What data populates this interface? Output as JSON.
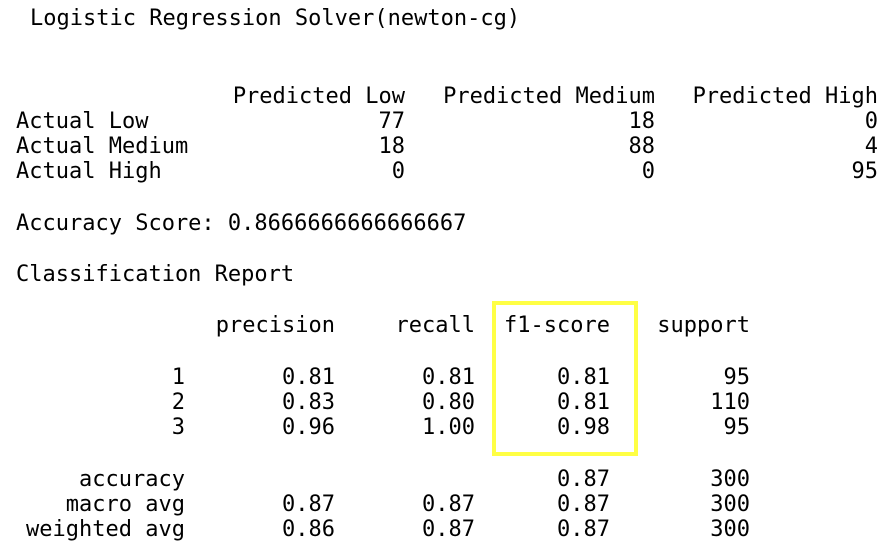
{
  "title": "Logistic Regression Solver(newton-cg)",
  "confusion_matrix": {
    "columns": [
      "Predicted Low",
      "Predicted Medium",
      "Predicted High"
    ],
    "rows": [
      {
        "label": "Actual Low",
        "values": [
          "77",
          "18",
          "0"
        ]
      },
      {
        "label": "Actual Medium",
        "values": [
          "18",
          "88",
          "4"
        ]
      },
      {
        "label": "Actual High",
        "values": [
          "0",
          "0",
          "95"
        ]
      }
    ]
  },
  "accuracy_line": "Accuracy Score: 0.8666666666666667",
  "report": {
    "title": "Classification Report",
    "headers": [
      "precision",
      "recall",
      "f1-score",
      "support"
    ],
    "class_rows": [
      {
        "label": "1",
        "precision": "0.81",
        "recall": "0.81",
        "f1": "0.81",
        "support": "95"
      },
      {
        "label": "2",
        "precision": "0.83",
        "recall": "0.80",
        "f1": "0.81",
        "support": "110"
      },
      {
        "label": "3",
        "precision": "0.96",
        "recall": "1.00",
        "f1": "0.98",
        "support": "95"
      }
    ],
    "summary_rows": [
      {
        "label": "accuracy",
        "precision": "",
        "recall": "",
        "f1": "0.87",
        "support": "300"
      },
      {
        "label": "macro avg",
        "precision": "0.87",
        "recall": "0.87",
        "f1": "0.87",
        "support": "300"
      },
      {
        "label": "weighted avg",
        "precision": "0.86",
        "recall": "0.87",
        "f1": "0.87",
        "support": "300"
      }
    ]
  },
  "colors": {
    "highlight_border": "#ffff44",
    "text": "#000000",
    "background": "#ffffff"
  }
}
